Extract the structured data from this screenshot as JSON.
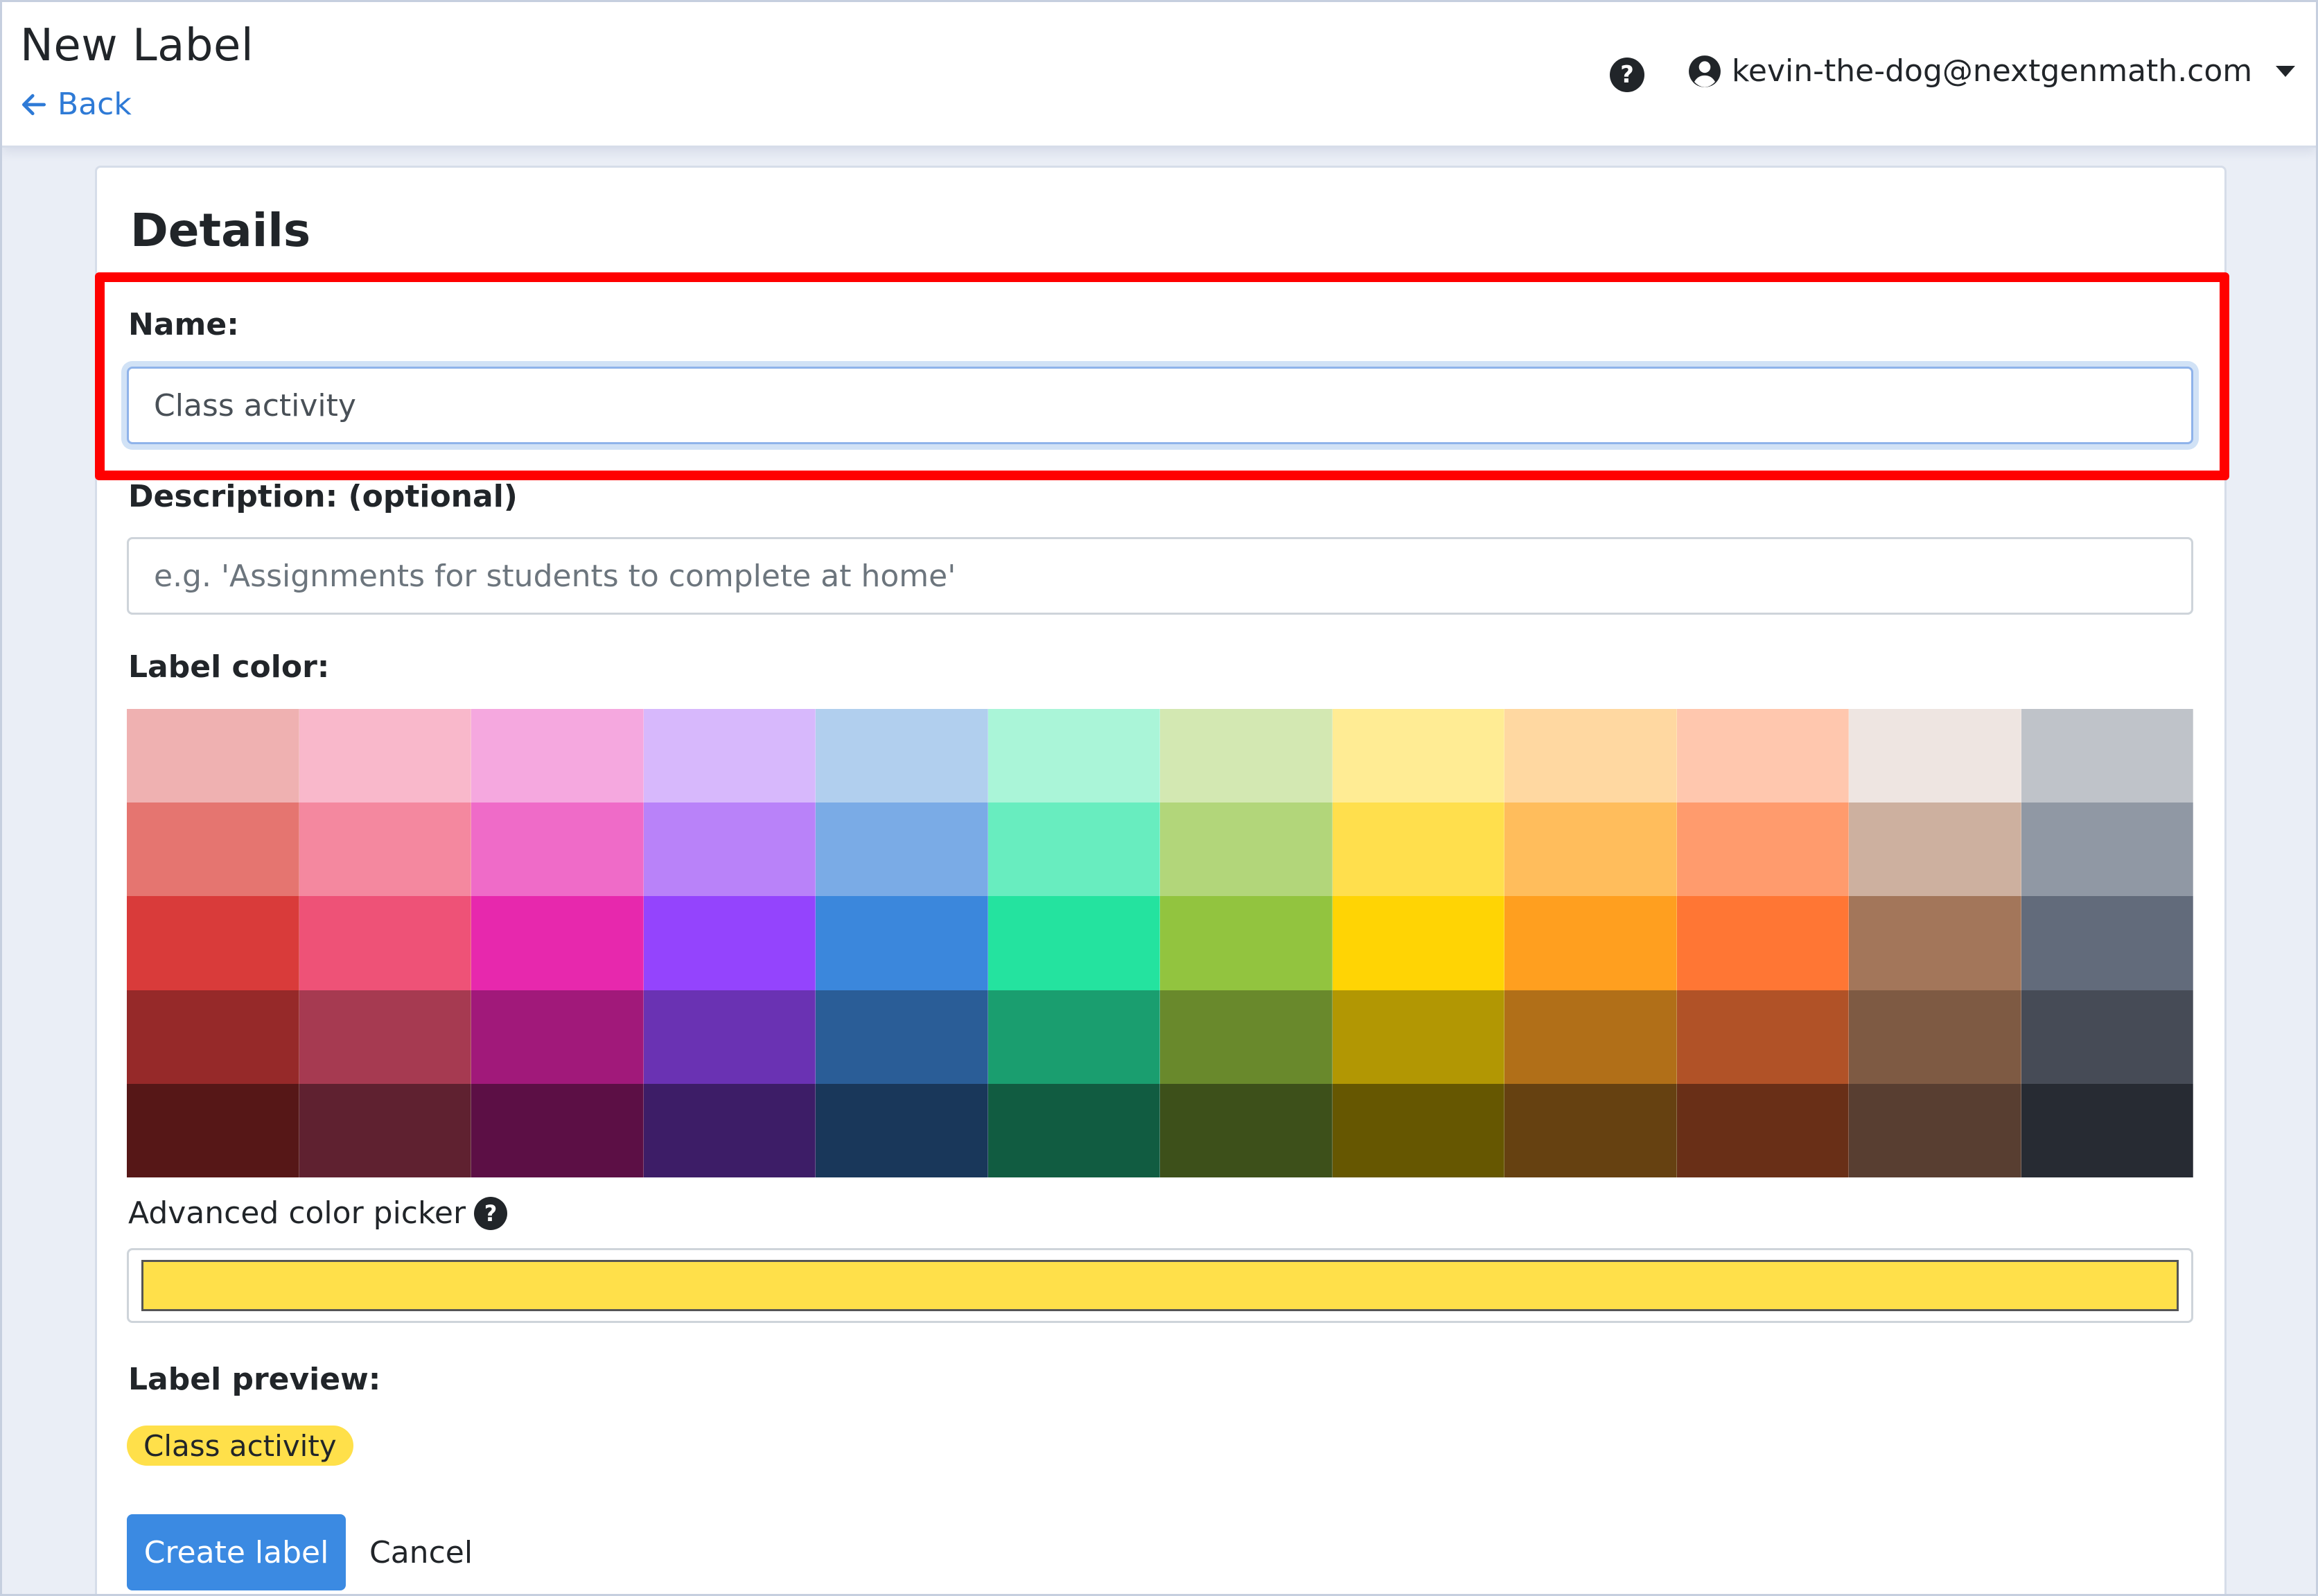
{
  "header": {
    "title": "New Label",
    "back_label": "Back",
    "help_glyph": "?",
    "user_email": "kevin-the-dog@nextgenmath.com"
  },
  "details": {
    "section_title": "Details",
    "name_label": "Name:",
    "name_value": "Class activity",
    "description_label": "Description: (optional)",
    "description_placeholder": "e.g. 'Assignments for students to complete at home'",
    "color_label": "Label color:",
    "advanced_picker_label": "Advanced color picker",
    "advanced_help_glyph": "?",
    "selected_color": "#ffe04a",
    "preview_label": "Label preview:",
    "preview_text": "Class activity"
  },
  "actions": {
    "create_label": "Create label",
    "cancel_label": "Cancel"
  },
  "palette": [
    [
      "#efb1b1",
      "#f9b8cb",
      "#f5a8df",
      "#d7b8fc",
      "#b1cfee",
      "#aaf5d8",
      "#d3e8b2",
      "#ffec94",
      "#ffd8a1",
      "#ffc7ae",
      "#eee5e1",
      "#bfc3c9"
    ],
    [
      "#e57570",
      "#f4889f",
      "#ef6bc8",
      "#b982f9",
      "#7aabe6",
      "#68edbf",
      "#b2d67a",
      "#ffdf4d",
      "#ffbd5c",
      "#ff9b6d",
      "#cdb09f",
      "#9098a4"
    ],
    [
      "#d93b3a",
      "#ee5277",
      "#e728ad",
      "#9444fd",
      "#3b87dc",
      "#24e39f",
      "#92c43f",
      "#ffd404",
      "#ff9f1f",
      "#ff7634",
      "#a3765a",
      "#626b7b"
    ],
    [
      "#962929",
      "#a63a51",
      "#a1197a",
      "#6a32b3",
      "#2a5d97",
      "#1a9e6f",
      "#69892c",
      "#b29703",
      "#b16f18",
      "#b15227",
      "#7e5a43",
      "#464b56"
    ],
    [
      "#561717",
      "#5f2130",
      "#5c0f45",
      "#3d1d67",
      "#19375a",
      "#115c41",
      "#3d501a",
      "#665701",
      "#664111",
      "#692f17",
      "#583e31",
      "#272b33"
    ]
  ]
}
